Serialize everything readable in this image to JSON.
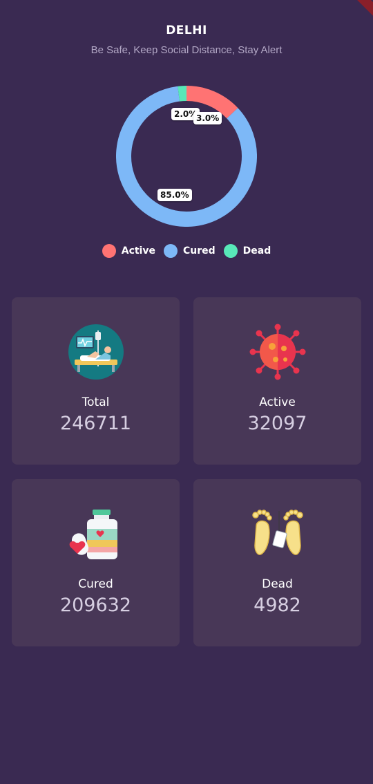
{
  "header": {
    "title": "DELHI",
    "subtitle": "Be Safe, Keep Social Distance, Stay Alert"
  },
  "chart_data": {
    "type": "pie",
    "categories": [
      "Active",
      "Cured",
      "Dead"
    ],
    "values": [
      13.0,
      85.0,
      2.0
    ],
    "labels_shown": [
      "3.0%",
      "85.0%",
      "2.0%"
    ],
    "colors": [
      "#ff7373",
      "#7db8f7",
      "#58e8b8"
    ],
    "legend_position": "bottom"
  },
  "legend": [
    {
      "label": "Active",
      "color": "#ff7373"
    },
    {
      "label": "Cured",
      "color": "#7db8f7"
    },
    {
      "label": "Dead",
      "color": "#58e8b8"
    }
  ],
  "cards": {
    "total": {
      "label": "Total",
      "value": "246711",
      "icon": "hospital-bed-icon"
    },
    "active": {
      "label": "Active",
      "value": "32097",
      "icon": "virus-icon"
    },
    "cured": {
      "label": "Cured",
      "value": "209632",
      "icon": "medicine-bottle-icon"
    },
    "dead": {
      "label": "Dead",
      "value": "4982",
      "icon": "feet-tag-icon"
    }
  }
}
